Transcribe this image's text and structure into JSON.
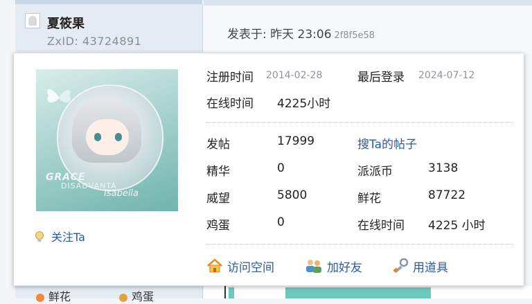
{
  "user": {
    "name": "夏筱果",
    "zxid": "ZxID:  43724891"
  },
  "post": {
    "meta": "发表于: 昨天 23:06",
    "hash": "2f8f5e58"
  },
  "profile_card": {
    "avatar_text": [
      "GRACE",
      "DISADVANTA",
      "Isabella"
    ],
    "follow_label": "关注Ta",
    "register_label": "注册时间",
    "register_value": "2014-02-28",
    "last_login_label": "最后登录",
    "last_login_value": "2024-07-12",
    "online_label": "在线时间",
    "online_value": "4225小时",
    "stats": {
      "posts_label": "发帖",
      "posts_value": "17999",
      "search_posts_label": "搜Ta的帖子",
      "essence_label": "精华",
      "essence_value": "0",
      "paipai_label": "派派币",
      "paipai_value": "3138",
      "prestige_label": "威望",
      "prestige_value": "5800",
      "flowers_label": "鲜花",
      "flowers_value": "87722",
      "eggs_label": "鸡蛋",
      "eggs_value": "0",
      "online2_label": "在线时间",
      "online2_value": "4225 小时"
    },
    "actions": {
      "visit_space": "访问空间",
      "add_friend": "加好友",
      "use_item": "用道具"
    }
  },
  "bottom": {
    "flower_label": "鲜花",
    "egg_label": "鸡蛋"
  },
  "icons": [
    "user-avatar-icon",
    "bulb-icon",
    "home-icon",
    "friends-icon",
    "tool-icon"
  ],
  "colors": {
    "link": "#2b5aa3",
    "accent": "#6dc8c0"
  }
}
